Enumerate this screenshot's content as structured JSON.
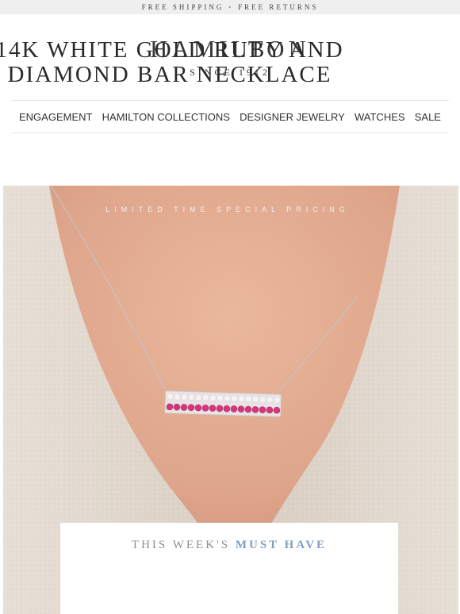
{
  "topbar": {
    "free_shipping": "FREE SHIPPING",
    "separator": "•",
    "free_returns": "FREE RETURNS"
  },
  "brand": {
    "name": "HAMILTON",
    "tagline": "SINCE 1912"
  },
  "nav": {
    "items": [
      {
        "label": "ENGAGEMENT"
      },
      {
        "label": "HAMILTON COLLECTIONS"
      },
      {
        "label": "DESIGNER JEWELRY"
      },
      {
        "label": "WATCHES"
      },
      {
        "label": "SALE"
      }
    ]
  },
  "hero": {
    "promo_text": "LIMITED TIME SPECIAL PRICING",
    "image_subject": "necklace-on-model",
    "colors": {
      "skin": "#e2aa8f",
      "sweater": "#e4dbd1",
      "ruby": "#d6367a",
      "diamond": "#f4f0f2"
    }
  },
  "feature": {
    "eyebrow_prefix": "THIS WEEK'S ",
    "eyebrow_accent": "MUST HAVE",
    "title_line1": "14K WHITE GOLD RUBY AND",
    "title_line2": "DIAMOND BAR NECKLACE",
    "accent_color": "#7f9ec0"
  }
}
